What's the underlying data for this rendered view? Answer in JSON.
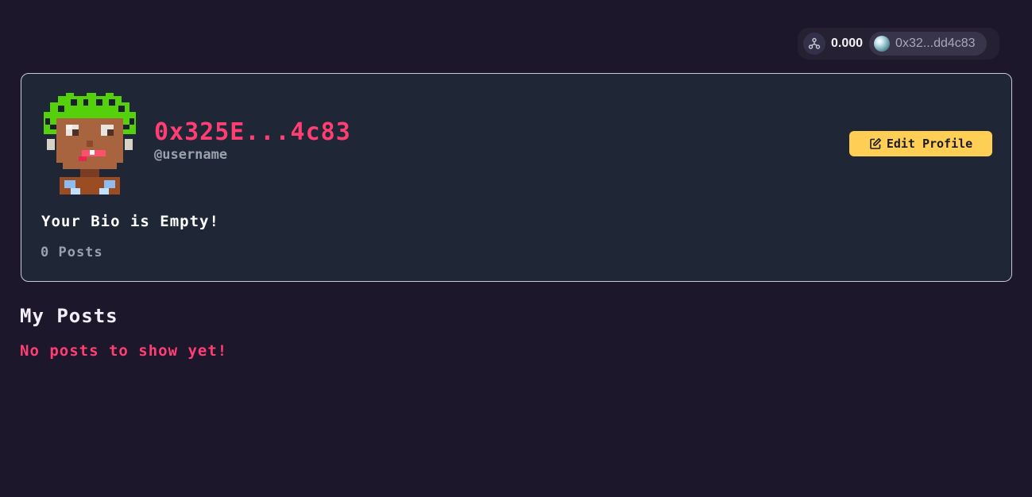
{
  "wallet": {
    "network_icon": "network-icon",
    "balance": "0.000",
    "account_icon": "account-orb-icon",
    "address": "0x32...dd4c83"
  },
  "profile": {
    "avatar": "pixel-avatar",
    "display_name": "0x325E...4c83",
    "handle": "@username",
    "edit_label": "Edit Profile",
    "edit_icon": "edit-icon",
    "bio": "Your Bio is Empty!",
    "post_count": "0 Posts"
  },
  "posts": {
    "title": "My Posts",
    "empty_message": "No posts to show yet!"
  },
  "colors": {
    "background": "#1d172b",
    "card": "#1f2736",
    "accent_pink": "#ff3f73",
    "accent_yellow": "#ffce55"
  }
}
